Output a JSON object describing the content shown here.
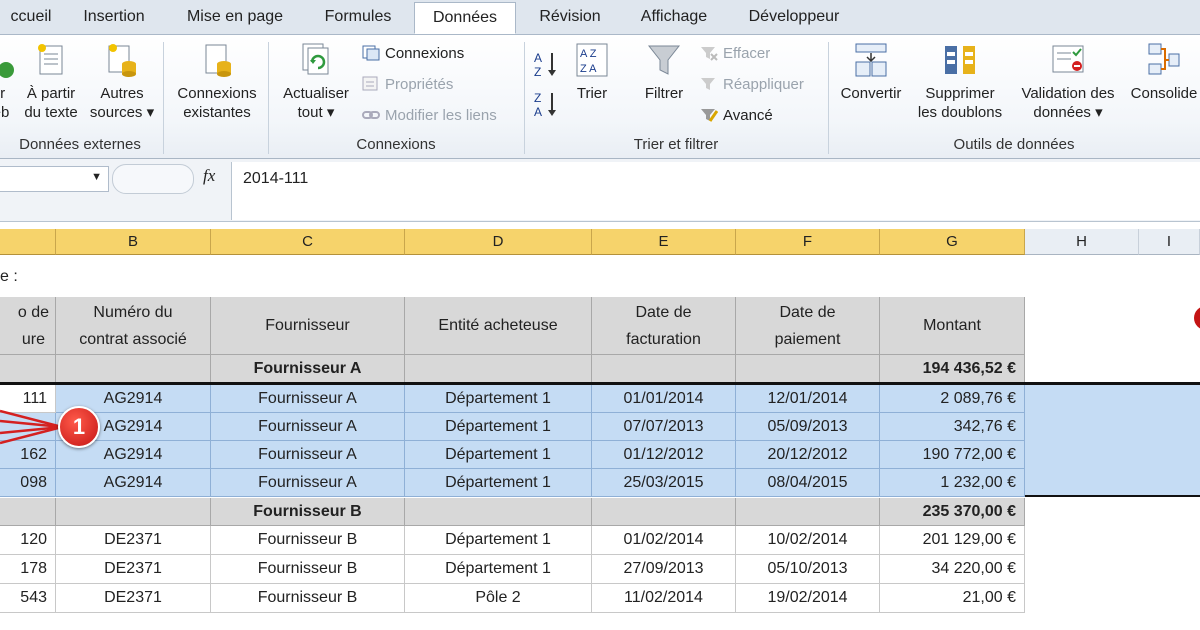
{
  "tabs": [
    "ccueil",
    "Insertion",
    "Mise en page",
    "Formules",
    "Données",
    "Révision",
    "Affichage",
    "Développeur"
  ],
  "ribbon": {
    "ext_data": {
      "buttons": [
        {
          "l1": "ir",
          "l2": "eb"
        },
        {
          "l1": "À partir",
          "l2": "du texte"
        },
        {
          "l1": "Autres",
          "l2": "sources ▾"
        }
      ],
      "label": "Données externes"
    },
    "existing": {
      "l1": "Connexions",
      "l2": "existantes"
    },
    "connections": {
      "refresh": {
        "l1": "Actualiser",
        "l2": "tout ▾"
      },
      "items": [
        "Connexions",
        "Propriétés",
        "Modifier les liens"
      ],
      "label": "Connexions"
    },
    "sort": {
      "sort_btn": "Trier",
      "filter_btn": "Filtrer",
      "items": [
        "Effacer",
        "Réappliquer",
        "Avancé"
      ],
      "label": "Trier et filtrer",
      "az_icon": "A↓Z",
      "za_icon": "Z↓A"
    },
    "tools": {
      "buttons": [
        {
          "l1": "Convertir",
          "l2": ""
        },
        {
          "l1": "Supprimer",
          "l2": "les doublons"
        },
        {
          "l1": "Validation des",
          "l2": "données ▾"
        },
        {
          "l1": "Consolide",
          "l2": ""
        }
      ],
      "label": "Outils de données"
    }
  },
  "formula_bar": {
    "fx": "fx",
    "value": "2014-111"
  },
  "columns": [
    "",
    "B",
    "C",
    "D",
    "E",
    "F",
    "G",
    "H",
    "I"
  ],
  "sheet": {
    "top_label": "e :",
    "headers": [
      "o de\nure",
      "Numéro du\ncontrat associé",
      "Fournisseur",
      "Entité acheteuse",
      "Date de\nfacturation",
      "Date de\npaiement",
      "Montant"
    ],
    "groups": [
      {
        "name": "Fournisseur A",
        "total": "194 436,52 €",
        "rows": [
          [
            "111",
            "AG2914",
            "Fournisseur A",
            "Département 1",
            "01/01/2014",
            "12/01/2014",
            "2 089,76 €"
          ],
          [
            "",
            "AG2914",
            "Fournisseur A",
            "Département 1",
            "07/07/2013",
            "05/09/2013",
            "342,76 €"
          ],
          [
            "162",
            "AG2914",
            "Fournisseur A",
            "Département 1",
            "01/12/2012",
            "20/12/2012",
            "190 772,00 €"
          ],
          [
            "098",
            "AG2914",
            "Fournisseur A",
            "Département 1",
            "25/03/2015",
            "08/04/2015",
            "1 232,00 €"
          ]
        ]
      },
      {
        "name": "Fournisseur B",
        "total": "235 370,00 €",
        "rows": [
          [
            "120",
            "DE2371",
            "Fournisseur B",
            "Département 1",
            "01/02/2014",
            "10/02/2014",
            "201 129,00 €"
          ],
          [
            "178",
            "DE2371",
            "Fournisseur B",
            "Département 1",
            "27/09/2013",
            "05/10/2013",
            "34 220,00 €"
          ],
          [
            "543",
            "DE2371",
            "Fournisseur B",
            "Pôle 2",
            "11/02/2014",
            "19/02/2014",
            "21,00 €"
          ]
        ]
      }
    ]
  },
  "annotation": {
    "badge": "1",
    "color": "#d42020"
  }
}
